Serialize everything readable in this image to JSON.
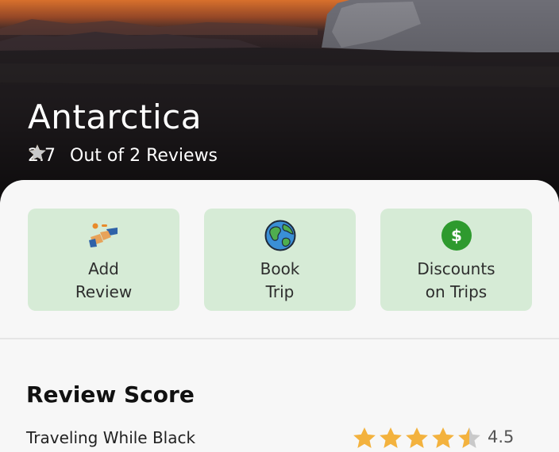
{
  "destination": {
    "name": "Antarctica",
    "rating": "2.7",
    "rating_value": 2.7,
    "reviews_text": "Out of 2 Reviews"
  },
  "actions": [
    {
      "label": "Add\nReview",
      "icon": "add-review-icon"
    },
    {
      "label": "Book\nTrip",
      "icon": "globe-icon"
    },
    {
      "label": "Discounts\non Trips",
      "icon": "dollar-icon"
    }
  ],
  "review_score": {
    "title": "Review Score",
    "items": [
      {
        "label": "Traveling While Black",
        "score": "4.5",
        "score_value": 4.5
      }
    ]
  },
  "colors": {
    "star": "#f3b23e",
    "star_empty": "#c9c9c9",
    "action_bg": "#d6ebd6",
    "dollar": "#2e9a2e"
  }
}
